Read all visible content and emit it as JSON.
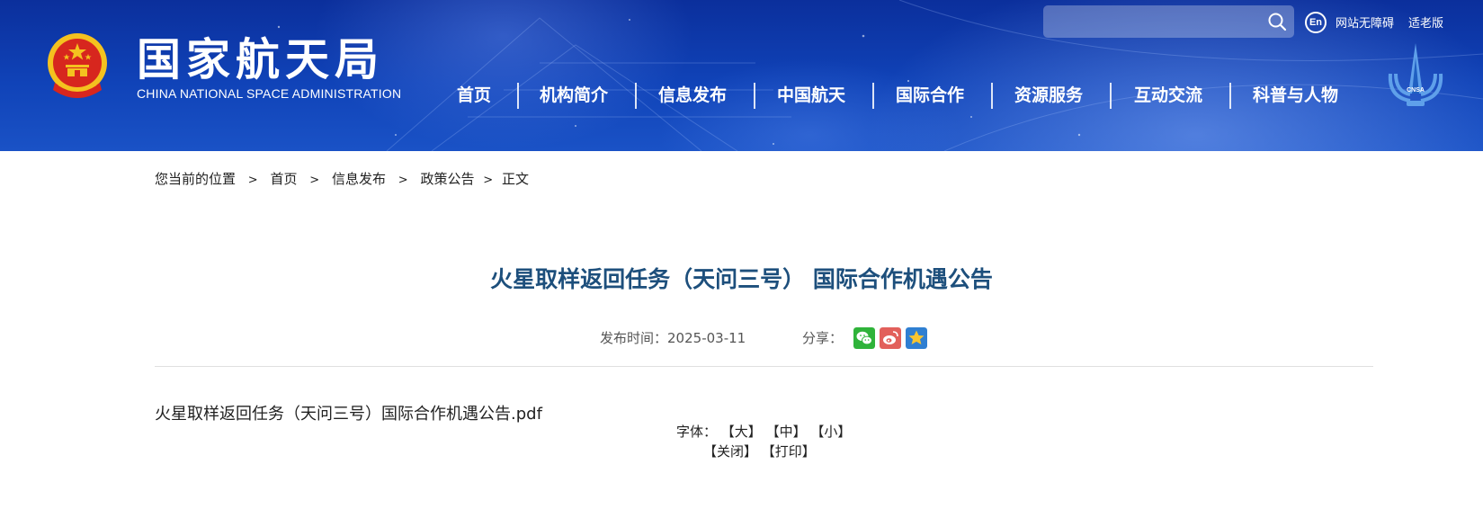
{
  "header": {
    "logo_cn": "国家航天局",
    "logo_en": "CHINA NATIONAL SPACE ADMINISTRATION",
    "search": {
      "placeholder": ""
    },
    "en_label": "En",
    "accessibility_link": "网站无障碍",
    "elderly_link": "适老版",
    "cnsa_badge_text": "CNSA",
    "nav": [
      {
        "label": "首页"
      },
      {
        "label": "机构简介"
      },
      {
        "label": "信息发布"
      },
      {
        "label": "中国航天"
      },
      {
        "label": "国际合作"
      },
      {
        "label": "资源服务"
      },
      {
        "label": "互动交流"
      },
      {
        "label": "科普与人物"
      }
    ]
  },
  "breadcrumb": {
    "prefix": "您当前的位置",
    "sep": ">",
    "items": [
      "首页",
      "信息发布",
      "政策公告",
      "正文"
    ]
  },
  "article": {
    "title": "火星取样返回任务（天问三号） 国际合作机遇公告",
    "publish_label": "发布时间：",
    "publish_date": "2025-03-11",
    "share_label": "分享：",
    "share_icons": [
      "wechat-icon",
      "weibo-icon",
      "favorite-star-icon"
    ],
    "attachment": "火星取样返回任务（天问三号）国际合作机遇公告.pdf"
  },
  "tools": {
    "font_label": "字体：",
    "font_large": "【大】",
    "font_medium": "【中】",
    "font_small": "【小】",
    "close": "【关闭】",
    "print": "【打印】"
  },
  "colors": {
    "banner_blue": "#1043b8",
    "title_blue": "#1d4f7c",
    "wechat_green": "#2fb33a",
    "weibo_red": "#e2605b",
    "star_blue": "#2f7fd2"
  }
}
